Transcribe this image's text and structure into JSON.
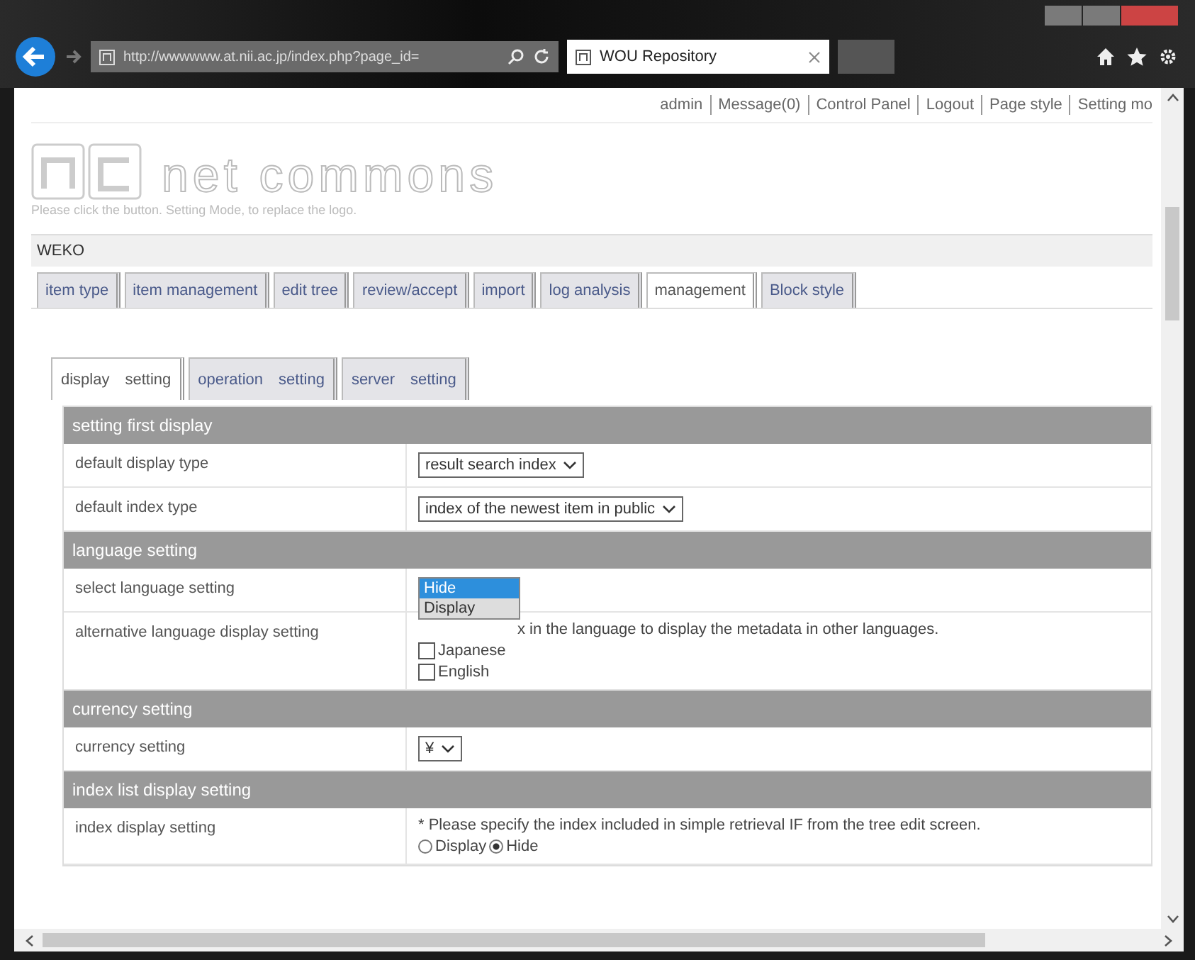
{
  "browser": {
    "address": "http://wwwwww.at.nii.ac.jp/index.php?page_id=",
    "tab_title": "WOU Repository"
  },
  "user_menu": [
    "admin",
    "Message(0)",
    "Control Panel",
    "Logout",
    "Page style",
    "Setting mo"
  ],
  "logo": {
    "text": "net commons",
    "hint": "Please click the button. Setting Mode, to replace the logo."
  },
  "module_title": "WEKO",
  "tabs": [
    {
      "label": "item type",
      "selected": false
    },
    {
      "label": "item management",
      "selected": false
    },
    {
      "label": "edit tree",
      "selected": false
    },
    {
      "label": "review/accept",
      "selected": false
    },
    {
      "label": "import",
      "selected": false
    },
    {
      "label": "log analysis",
      "selected": false
    },
    {
      "label": "management",
      "selected": true
    },
    {
      "label": "Block style",
      "selected": false
    }
  ],
  "subtabs": [
    {
      "label": "display　setting",
      "selected": true
    },
    {
      "label": "operation　setting",
      "selected": false
    },
    {
      "label": "server　setting",
      "selected": false
    }
  ],
  "sections": [
    {
      "title": "setting first display",
      "rows": [
        {
          "label": "default display type",
          "kind": "select",
          "value": "result search index"
        },
        {
          "label": "default index type",
          "kind": "select",
          "value": "index of the newest item in public"
        }
      ]
    },
    {
      "title": "language setting",
      "rows": [
        {
          "label": "select language setting",
          "kind": "listbox",
          "options": [
            {
              "label": "Hide",
              "selected": true
            },
            {
              "label": "Display",
              "selected": false
            }
          ]
        },
        {
          "label": "alternative language display setting",
          "kind": "checklist",
          "note": "x in the language to display the metadata in other languages.",
          "options": [
            {
              "label": "Japanese",
              "checked": false
            },
            {
              "label": "English",
              "checked": false
            }
          ]
        }
      ]
    },
    {
      "title": "currency setting",
      "rows": [
        {
          "label": "currency setting",
          "kind": "select",
          "value": "¥"
        }
      ]
    },
    {
      "title": "index list display setting",
      "rows": [
        {
          "label": "index display setting",
          "kind": "radio",
          "note": "* Please specify the index included in simple retrieval IF from the tree edit screen.",
          "options": [
            {
              "label": "Display",
              "selected": false
            },
            {
              "label": "Hide",
              "selected": true
            }
          ]
        }
      ]
    }
  ]
}
